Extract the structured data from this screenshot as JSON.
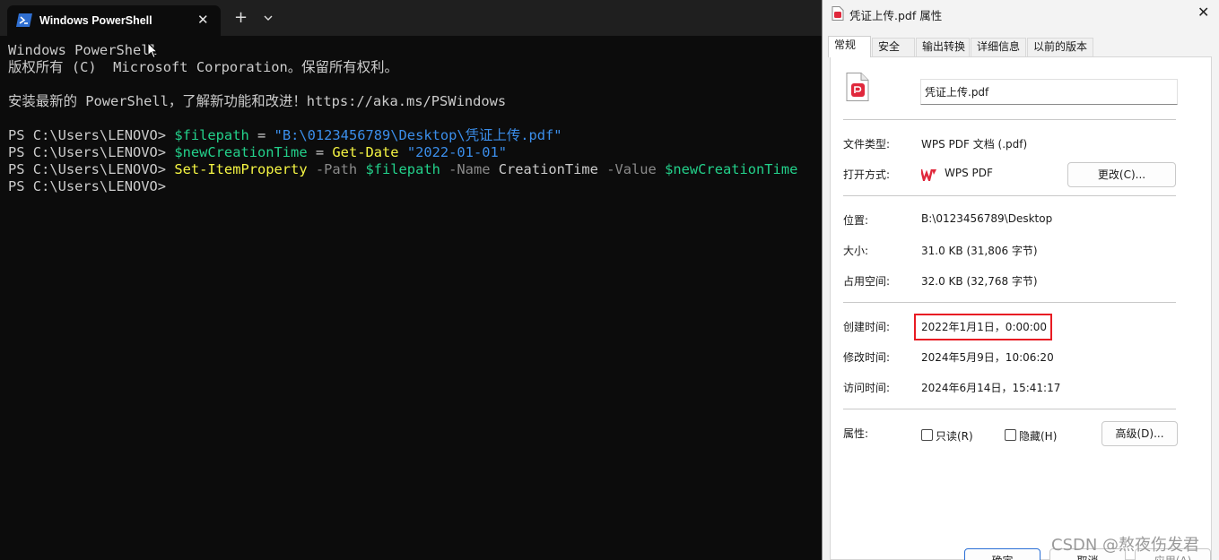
{
  "terminal": {
    "tab_title": "Windows PowerShell",
    "close_glyph": "✕",
    "new_tab_glyph": "+",
    "lines": {
      "l1": "Windows PowerShell",
      "l2": "版权所有 (C)  Microsoft Corporation。保留所有权利。",
      "l3": "安装最新的 PowerShell，了解新功能和改进！https://aka.ms/PSWindows",
      "prompt": "PS C:\\Users\\LENOVO> ",
      "cmd1": {
        "var": "$filepath",
        "op": " = ",
        "str": "\"B:\\0123456789\\Desktop\\凭证上传.pdf\""
      },
      "cmd2": {
        "var": "$newCreationTime",
        "op": " = ",
        "cmd": "Get-Date",
        "str": " \"2022-01-01\""
      },
      "cmd3": {
        "cmd": "Set-ItemProperty",
        "p1": " -Path ",
        "v1": "$filepath",
        "p2": " -Name ",
        "a2": "CreationTime",
        "p3": " -Value ",
        "v3": "$newCreationTime"
      }
    }
  },
  "dialog": {
    "title": "凭证上传.pdf 属性",
    "close_glyph": "✕",
    "tabs": [
      "常规",
      "安全",
      "输出转换",
      "详细信息",
      "以前的版本"
    ],
    "file_name": "凭证上传.pdf",
    "file_type_label": "文件类型:",
    "file_type_value": "WPS PDF 文档 (.pdf)",
    "open_with_label": "打开方式:",
    "open_with_value": "WPS PDF",
    "change_button": "更改(C)...",
    "location_label": "位置:",
    "location_value": "B:\\0123456789\\Desktop",
    "size_label": "大小:",
    "size_value": "31.0 KB (31,806 字节)",
    "disk_size_label": "占用空间:",
    "disk_size_value": "32.0 KB (32,768 字节)",
    "created_label": "创建时间:",
    "created_value": "2022年1月1日，0:00:00",
    "modified_label": "修改时间:",
    "modified_value": "2024年5月9日，10:06:20",
    "accessed_label": "访问时间:",
    "accessed_value": "2024年6月14日，15:41:17",
    "attributes_label": "属性:",
    "readonly_label": "只读(R)",
    "hidden_label": "隐藏(H)",
    "advanced_button": "高级(D)...",
    "ok_button": "确定",
    "cancel_button": "取消",
    "apply_button": "应用(A)"
  },
  "watermark": "CSDN @熬夜伤发君",
  "colors": {
    "highlight": "#e81b23",
    "terminal_bg": "#0c0c0c",
    "wps_red": "#e0283c"
  }
}
